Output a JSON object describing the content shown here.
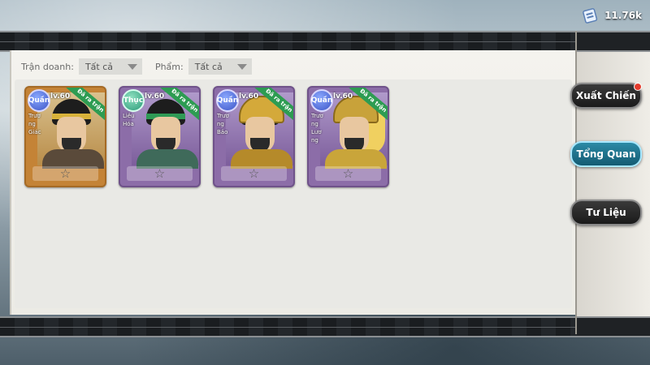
{
  "currency": {
    "icon": "scroll-ticket-icon",
    "value": "11.76k"
  },
  "filters": {
    "faction_label": "Trận doanh:",
    "faction_value": "Tất cả",
    "grade_label": "Phẩm:",
    "grade_value": "Tất cả"
  },
  "heroes": [
    {
      "faction": "Quần",
      "level": "lv.60",
      "status": "Đã ra trận",
      "name": "Trương Giác",
      "stars": 1,
      "color": "orange"
    },
    {
      "faction": "Thục",
      "level": "lv.60",
      "status": "Đã ra trận",
      "name": "Liêu Hóa",
      "stars": 1,
      "color": "purple"
    },
    {
      "faction": "Quần",
      "level": "lv.60",
      "status": "Đã ra trận",
      "name": "Trương Bảo",
      "stars": 1,
      "color": "purple"
    },
    {
      "faction": "Quần",
      "level": "lv.60",
      "status": "Đã ra trận",
      "name": "Trương Lương",
      "stars": 1,
      "color": "purple"
    }
  ],
  "side_menu": {
    "deploy": "Xuất Chiến",
    "overview": "Tổng Quan",
    "archive": "Tư Liệu"
  }
}
